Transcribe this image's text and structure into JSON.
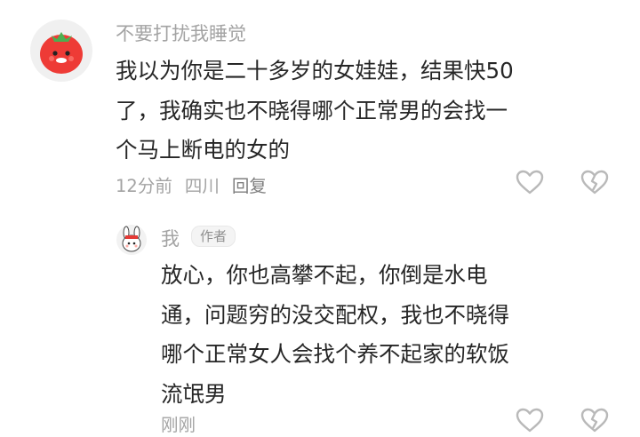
{
  "comments": [
    {
      "username": "不要打扰我睡觉",
      "avatar": "tomato-avatar",
      "lines": [
        "我以为你是二十多岁的女娃娃，结果快50",
        "了，我确实也不晓得哪个正常男的会找一",
        "个马上断电的女的"
      ],
      "time": "12分前",
      "location": "四川",
      "reply_label": "回复"
    }
  ],
  "reply": {
    "username": "我",
    "tag": "作者",
    "avatar": "bunny-avatar",
    "lines": [
      "放心，你也高攀不起，你倒是水电",
      "通，问题穷的没交配权，我也不晓得",
      "哪个正常女人会找个养不起家的软饭",
      "流氓男"
    ],
    "time": "刚刚"
  },
  "icons": {
    "like": "heart-outline-icon",
    "dislike": "broken-heart-icon"
  },
  "colors": {
    "muted_text": "#a3a3a3",
    "content_text": "#262626",
    "tomato_red": "#ee3b36",
    "icon_stroke": "#b9b9b9"
  }
}
